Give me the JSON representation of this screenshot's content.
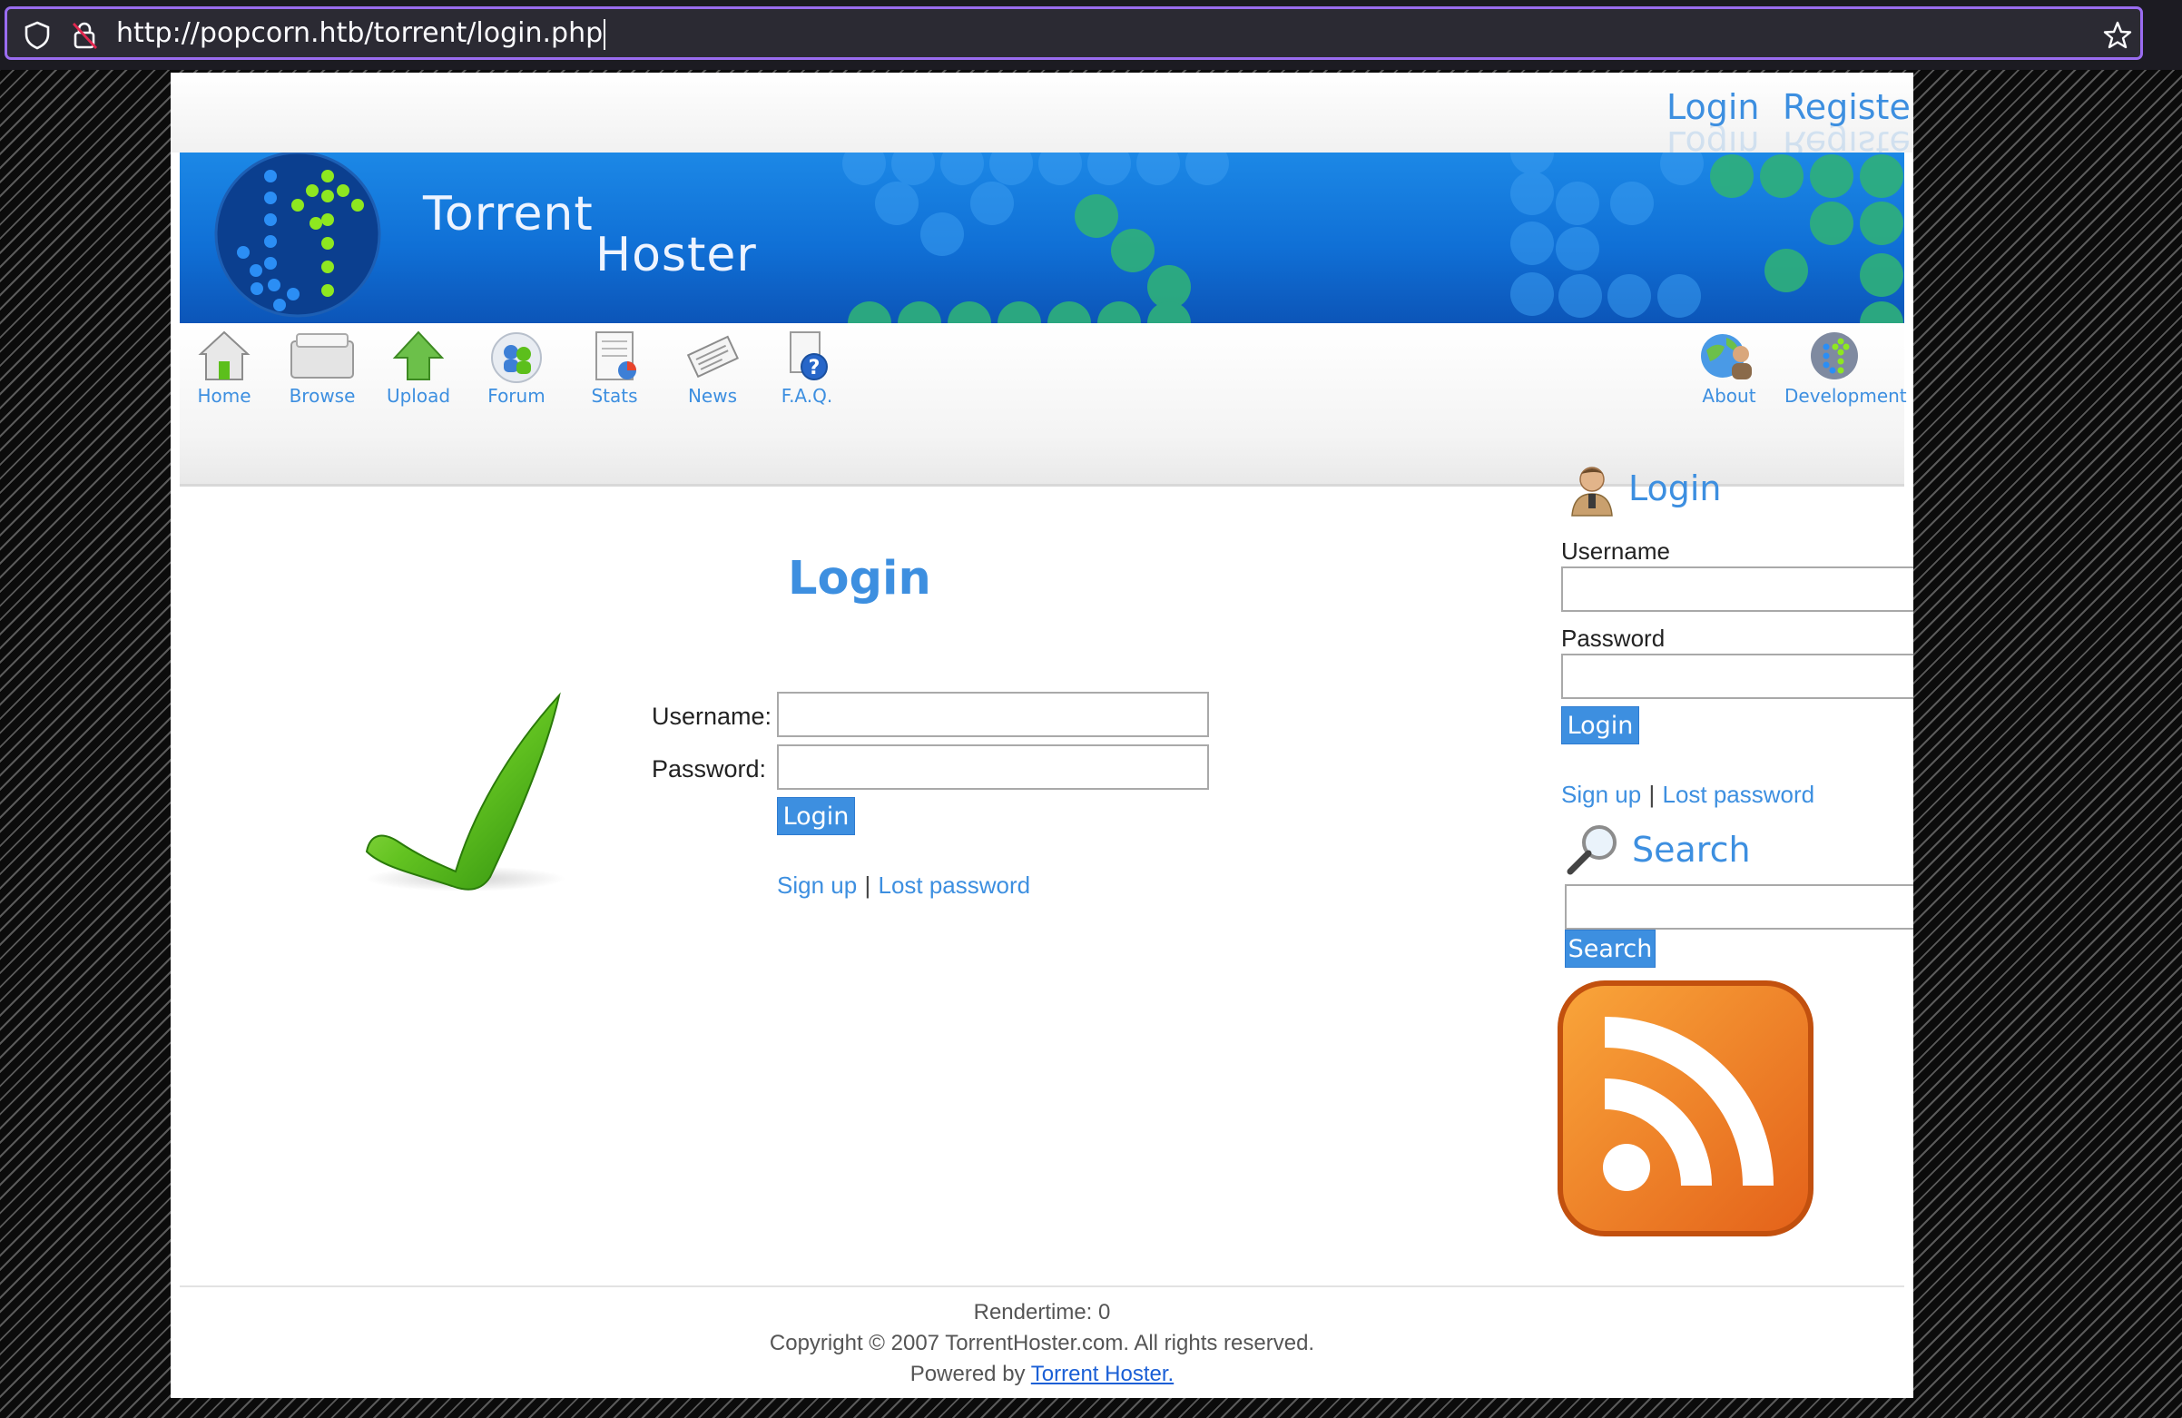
{
  "browser": {
    "url": "http://popcorn.htb/torrent/login.php"
  },
  "top_links": {
    "login": "Login",
    "register": "Register"
  },
  "banner": {
    "title_line1": "Torrent",
    "title_line2": "Hoster"
  },
  "nav": {
    "items": [
      {
        "label": "Home",
        "icon": "home-icon"
      },
      {
        "label": "Browse",
        "icon": "folder-icon"
      },
      {
        "label": "Upload",
        "icon": "upload-arrow-icon"
      },
      {
        "label": "Forum",
        "icon": "forum-users-icon"
      },
      {
        "label": "Stats",
        "icon": "stats-chart-icon"
      },
      {
        "label": "News",
        "icon": "newspaper-icon"
      },
      {
        "label": "F.A.Q.",
        "icon": "faq-help-icon"
      }
    ],
    "right_items": [
      {
        "label": "About",
        "icon": "about-globe-icon"
      },
      {
        "label": "Development",
        "icon": "development-globe-icon"
      }
    ]
  },
  "main": {
    "title": "Login",
    "username_label": "Username:",
    "password_label": "Password:",
    "username_value": "",
    "password_value": "",
    "login_button": "Login",
    "signup_link": "Sign up",
    "separator": "|",
    "lost_password_link": "Lost password"
  },
  "sidebar": {
    "login_heading": "Login",
    "username_label": "Username",
    "password_label": "Password",
    "username_value": "",
    "password_value": "",
    "login_button": "Login",
    "signup_link": "Sign up",
    "separator": "|",
    "lost_password_link": "Lost password",
    "search_heading": "Search",
    "search_value": "",
    "search_button": "Search"
  },
  "footer": {
    "rendertime": "Rendertime: 0",
    "copyright": "Copyright © 2007 TorrentHoster.com. All rights reserved.",
    "powered_prefix": "Powered by",
    "powered_link": "Torrent Hoster."
  },
  "colors": {
    "accent": "#3d8fe0",
    "url_focus_border": "#9a6cf0",
    "checkmark_green": "#5cbf1c",
    "rss_orange": "#f08a24"
  }
}
